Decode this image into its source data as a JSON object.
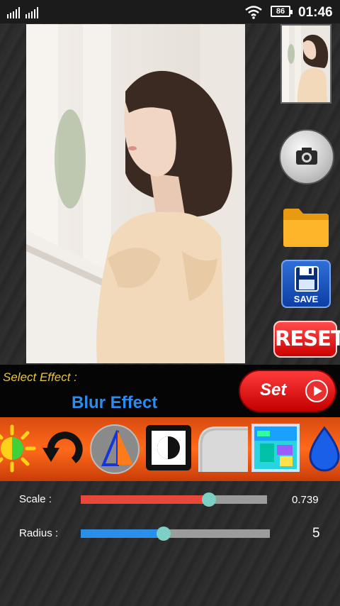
{
  "status": {
    "time": "01:46",
    "battery": "86"
  },
  "select_effect_label": "Select Effect :",
  "effect_name": "Blur Effect",
  "set_label": "Set",
  "save_label": "SAVE",
  "reset_label": "RESET",
  "tools": [
    "brightness-icon",
    "rotate-icon",
    "sharpen-icon",
    "contrast-icon",
    "corner-icon",
    "color-map-icon",
    "water-drop-icon"
  ],
  "scale": {
    "label": "Scale  :",
    "value": "0.739",
    "level": 0.69
  },
  "radius": {
    "label": "Radius :",
    "value": "5",
    "level": 0.44
  },
  "colors": {
    "scale_fill": "#e8473a",
    "radius_fill": "#2a8fe8",
    "knob": "#7fd0c4"
  }
}
